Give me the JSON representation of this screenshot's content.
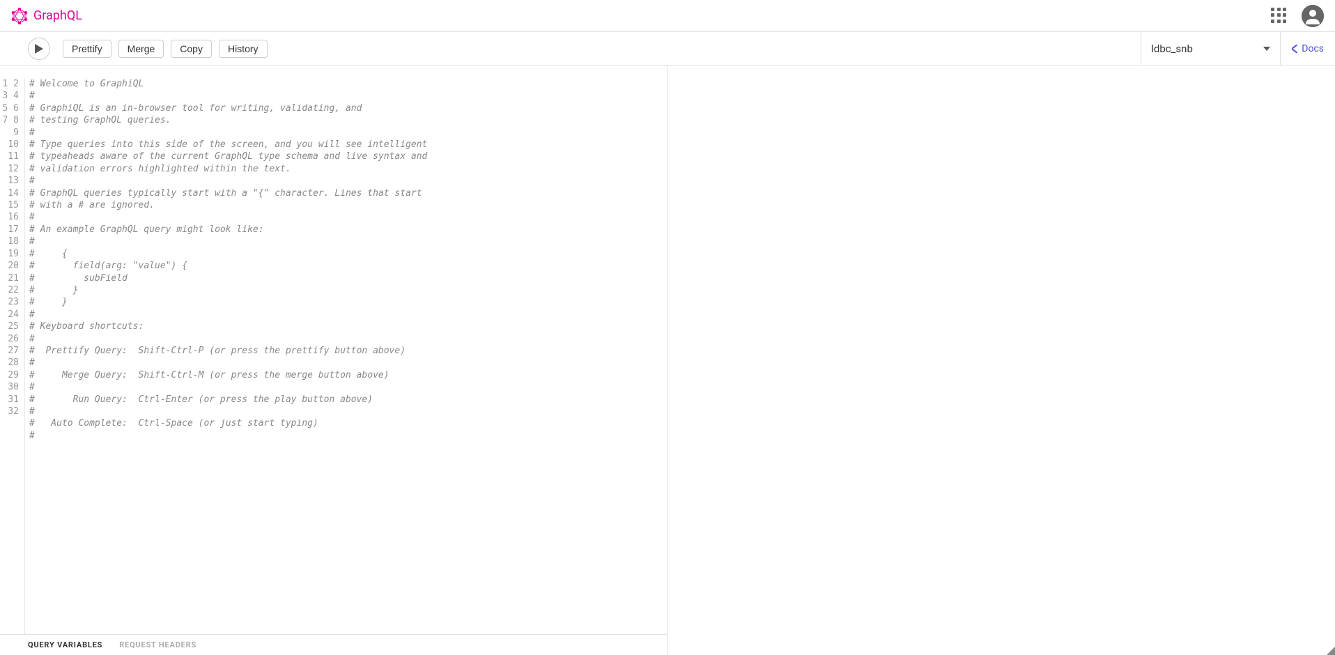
{
  "header": {
    "logo_text": "GraphQL"
  },
  "toolbar": {
    "prettify_label": "Prettify",
    "merge_label": "Merge",
    "copy_label": "Copy",
    "history_label": "History",
    "schema_selected": "ldbc_snb",
    "docs_label": "Docs"
  },
  "editor": {
    "lines": [
      "# Welcome to GraphiQL",
      "#",
      "# GraphiQL is an in-browser tool for writing, validating, and",
      "# testing GraphQL queries.",
      "#",
      "# Type queries into this side of the screen, and you will see intelligent",
      "# typeaheads aware of the current GraphQL type schema and live syntax and",
      "# validation errors highlighted within the text.",
      "#",
      "# GraphQL queries typically start with a \"{\" character. Lines that start",
      "# with a # are ignored.",
      "#",
      "# An example GraphQL query might look like:",
      "#",
      "#     {",
      "#       field(arg: \"value\") {",
      "#         subField",
      "#       }",
      "#     }",
      "#",
      "# Keyboard shortcuts:",
      "#",
      "#  Prettify Query:  Shift-Ctrl-P (or press the prettify button above)",
      "#",
      "#     Merge Query:  Shift-Ctrl-M (or press the merge button above)",
      "#",
      "#       Run Query:  Ctrl-Enter (or press the play button above)",
      "#",
      "#   Auto Complete:  Ctrl-Space (or just start typing)",
      "#",
      "",
      ""
    ]
  },
  "tabs": {
    "variables_label": "QUERY VARIABLES",
    "headers_label": "REQUEST HEADERS"
  }
}
